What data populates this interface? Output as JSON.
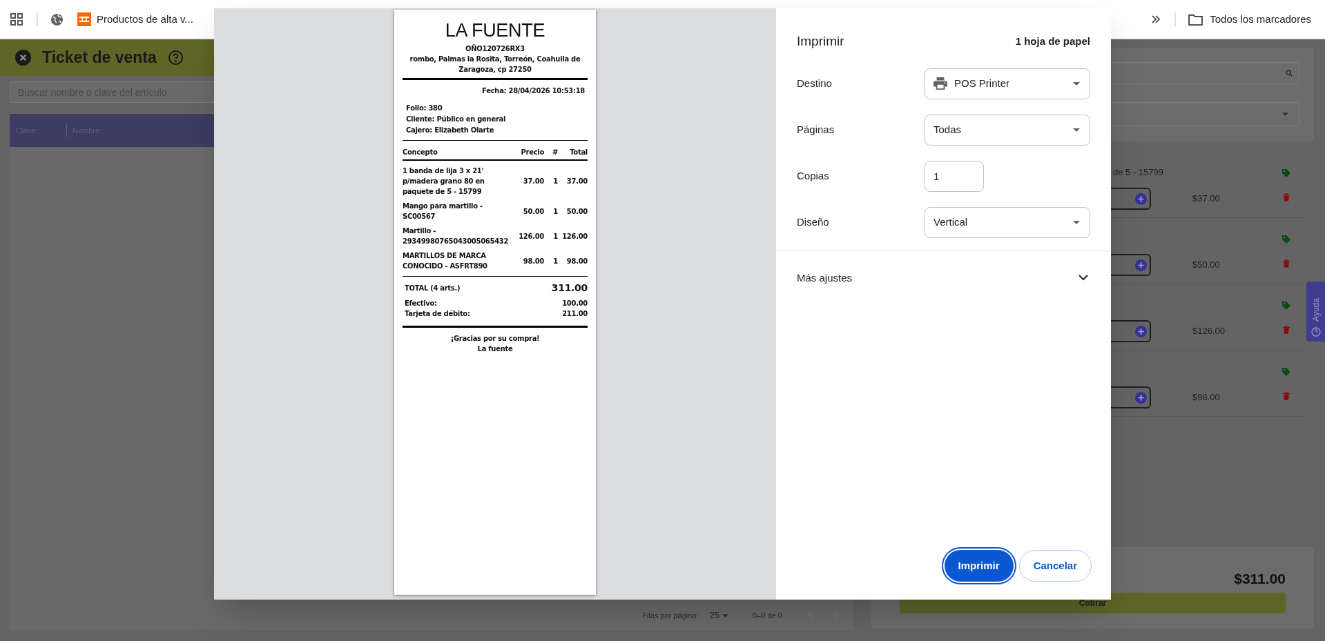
{
  "browser_bar": {
    "bookmarks": [
      {
        "label": "Productos de alta v..."
      }
    ],
    "all_bookmarks": "Todos los marcadores"
  },
  "app": {
    "title": "Ticket de venta",
    "search_placeholder": "Buscar nombre o clave del artículo",
    "table": {
      "columns": [
        "Clave",
        "Nombre"
      ]
    },
    "pagination": {
      "rows_label": "Filas por página:",
      "rows_value": "25",
      "range": "0–0 de 0"
    },
    "cart": {
      "partial_text": "de 5 - 15799",
      "items": [
        {
          "price": "$37.00"
        },
        {
          "price": "$50.00"
        },
        {
          "price": "$126.00"
        },
        {
          "price": "$98.00"
        }
      ],
      "total": "$311.00",
      "charge_button": "Cobrar"
    },
    "help_tab": "Ayuda"
  },
  "receipt": {
    "business": "LA FUENTE",
    "rfc": "OÑO120726RX3",
    "address": "rombo, Palmas la Rosita, Torreón, Coahuila de Zaragoza, cp 27250",
    "date": "Fecha: 28/04/2026 10:53:18",
    "info": [
      "Folio: 380",
      "Cliente: Público en general",
      "Cajero: Elizabeth Olarte"
    ],
    "columns": [
      "Concepto",
      "Precio",
      "#",
      "Total"
    ],
    "lines": [
      {
        "concept": "1 banda de lija 3 x 21' p/madera grano 80 en paquete de 5 - 15799",
        "price": "37.00",
        "qty": "1",
        "total": "37.00"
      },
      {
        "concept": "Mango para martillo - SC00567",
        "price": "50.00",
        "qty": "1",
        "total": "50.00"
      },
      {
        "concept": "Martillo - 29349980765043005065432",
        "price": "126.00",
        "qty": "1",
        "total": "126.00"
      },
      {
        "concept": "MARTILLOS DE MARCA CONOCIDO - ASFRT890",
        "price": "98.00",
        "qty": "1",
        "total": "98.00"
      }
    ],
    "total_label": "TOTAL (4 arts.)",
    "total": "311.00",
    "payments": [
      {
        "label": "Efectivo:",
        "amount": "100.00"
      },
      {
        "label": "Tarjeta de débito:",
        "amount": "211.00"
      }
    ],
    "footer": [
      "¡Gracias por su compra!",
      "La fuente"
    ]
  },
  "print_dialog": {
    "title": "Imprimir",
    "sheets": "1 hoja de papel",
    "fields": [
      {
        "label": "Destino",
        "kind": "printer_select",
        "value": "POS Printer"
      },
      {
        "label": "Páginas",
        "kind": "select",
        "value": "Todas"
      },
      {
        "label": "Copias",
        "kind": "input",
        "value": "1"
      },
      {
        "label": "Diseño",
        "kind": "select",
        "value": "Vertical"
      }
    ],
    "more_settings": "Más ajustes",
    "buttons": [
      {
        "label": "Imprimir",
        "kind": "primary"
      },
      {
        "label": "Cancelar",
        "kind": "secondary"
      }
    ]
  }
}
